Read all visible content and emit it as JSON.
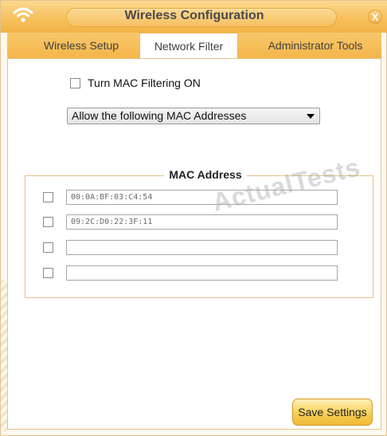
{
  "window": {
    "title": "Wireless Configuration",
    "close_glyph": "X"
  },
  "tabs": [
    {
      "label": "Wireless Setup",
      "active": false
    },
    {
      "label": "Network Filter",
      "active": true
    },
    {
      "label": "Administrator Tools",
      "active": false
    }
  ],
  "mac_filter": {
    "label": "Turn MAC Filtering ON",
    "checked": false,
    "mode_selected": "Allow the following MAC Addresses"
  },
  "mac_list": {
    "legend": "MAC Address",
    "rows": [
      {
        "checked": false,
        "value": "00:0A:BF:03:C4:54"
      },
      {
        "checked": false,
        "value": "09:2C:D0:22:3F:11"
      },
      {
        "checked": false,
        "value": ""
      },
      {
        "checked": false,
        "value": ""
      }
    ]
  },
  "watermark": "ActualTests",
  "save_button": "Save Settings",
  "icons": {
    "wifi": "wifi-icon",
    "close": "close-icon",
    "dropdown": "chevron-down-icon"
  },
  "colors": {
    "accent": "#f6be5a",
    "border": "#e3c48a",
    "button": "#f7cf57"
  }
}
